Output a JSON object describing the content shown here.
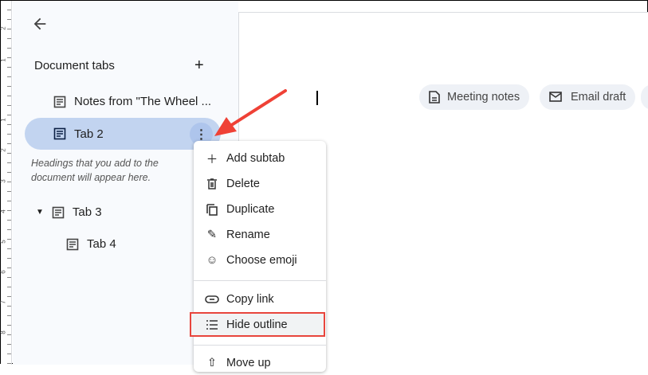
{
  "ruler": {
    "numbers": [
      "2",
      "1",
      "1",
      "2",
      "3",
      "4",
      "5",
      "6",
      "7",
      "8"
    ]
  },
  "sidebar": {
    "title": "Document tabs",
    "tabs": [
      {
        "label": "Notes from \"The Wheel ..."
      },
      {
        "label": "Tab 2"
      },
      {
        "label": "Tab 3"
      },
      {
        "label": "Tab 4"
      }
    ],
    "hint": "Headings that you add to the document will appear here."
  },
  "menu": {
    "items": [
      "Add subtab",
      "Delete",
      "Duplicate",
      "Rename",
      "Choose emoji",
      "Copy link",
      "Hide outline",
      "Move up"
    ]
  },
  "chips": [
    "Meeting notes",
    "Email draft"
  ],
  "colors": {
    "selected": "#c2d4f0",
    "annotation": "#e8453c"
  }
}
